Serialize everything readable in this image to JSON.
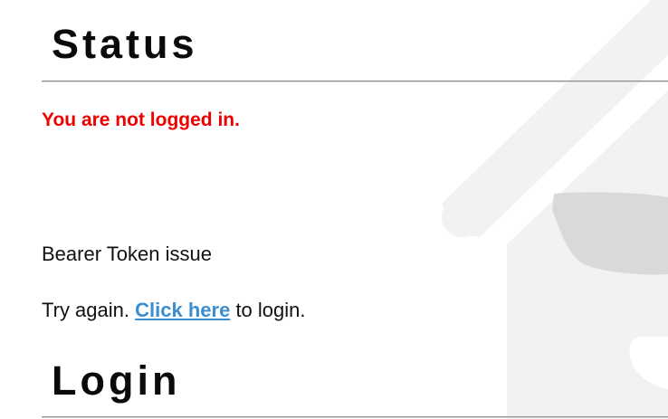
{
  "status_section": {
    "title": "Status",
    "alert": "You are not logged in."
  },
  "message": {
    "issue": "Bearer Token issue",
    "retry_prefix": "Try again.",
    "link_label": "Click here",
    "retry_suffix": "to login."
  },
  "login_section": {
    "title": "Login"
  },
  "colors": {
    "alert": "#ee0000",
    "link": "#3b8ed0",
    "watermark": "#f2f2f2",
    "watermark_glasses": "#d9d9d9"
  },
  "icons": {
    "background": "house-with-sunglasses-watermark-icon"
  }
}
